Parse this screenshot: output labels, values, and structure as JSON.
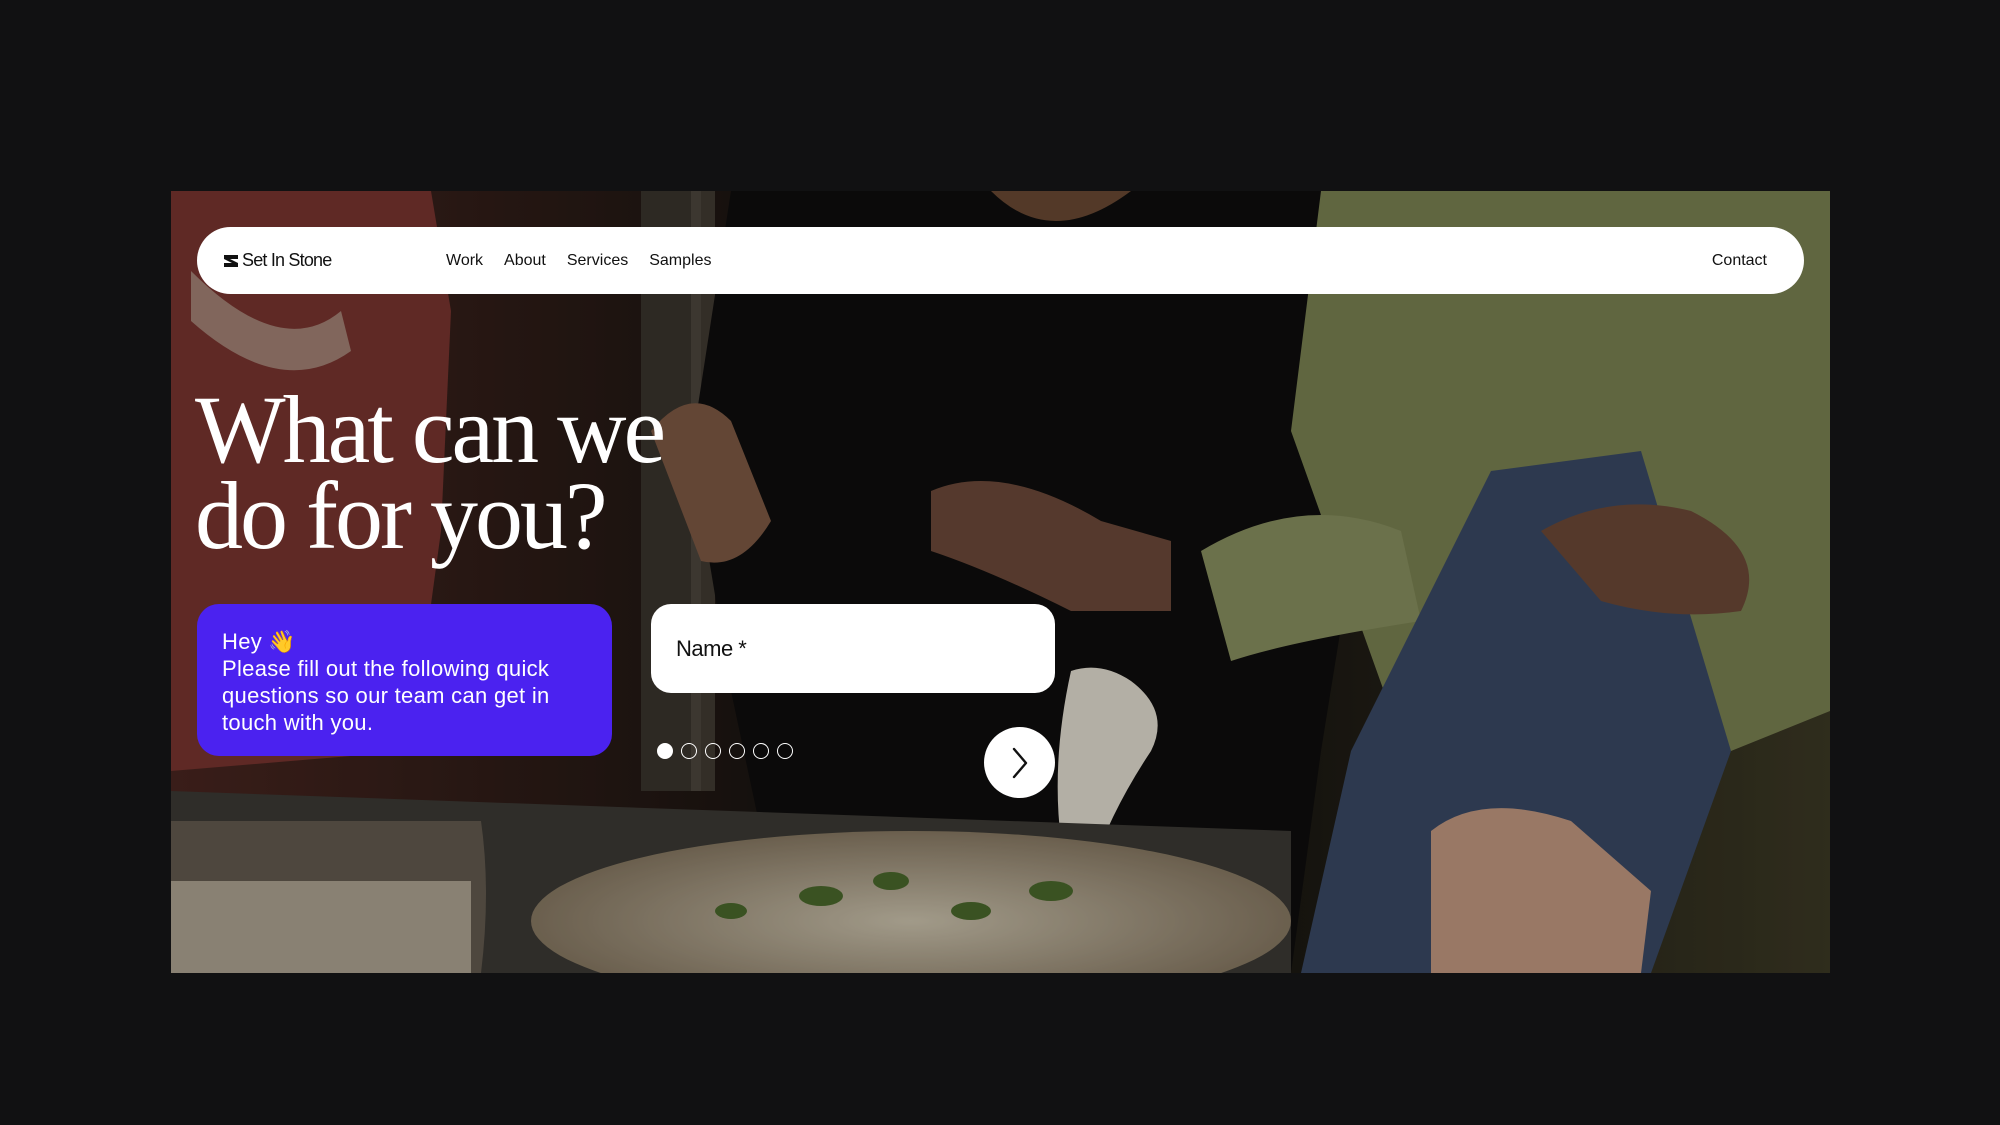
{
  "brand": {
    "name": "Set In Stone",
    "logo_icon": "stone-logo-icon"
  },
  "nav": {
    "links": [
      "Work",
      "About",
      "Services",
      "Samples"
    ],
    "contact": "Contact"
  },
  "hero": {
    "headline": "What can we\ndo for you?"
  },
  "chat": {
    "greeting": "Hey 👋",
    "message": "Please fill out the following quick questions so our team can get in touch with you."
  },
  "form": {
    "name_placeholder": "Name *",
    "steps_total": 6,
    "current_step": 1,
    "next_icon": "chevron-right-icon"
  },
  "colors": {
    "background": "#111112",
    "accent": "#4b22f0",
    "surface": "#ffffff"
  }
}
